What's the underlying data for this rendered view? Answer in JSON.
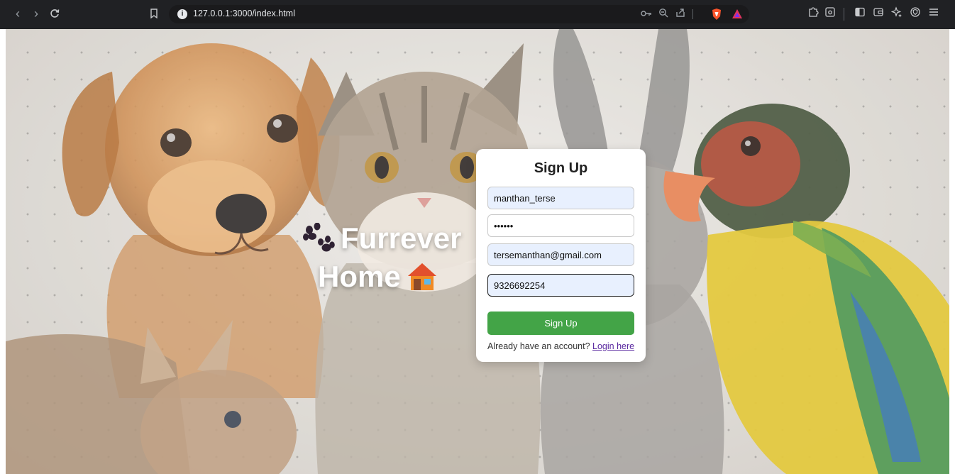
{
  "browser": {
    "url": "127.0.0.1:3000/index.html"
  },
  "brand": {
    "line1": "Furrever",
    "line2": "Home"
  },
  "signup": {
    "title": "Sign Up",
    "username_value": "manthan_terse",
    "password_value": "••••••",
    "email_value": "tersemanthan@gmail.com",
    "phone_value": "9326692254",
    "submit_label": "Sign Up",
    "login_prompt": "Already have an account?",
    "login_link": "Login here"
  },
  "colors": {
    "button_green": "#43a447",
    "link_purple": "#5b2aa0",
    "autofill_blue": "#e8f0fe",
    "chrome_dark": "#202124"
  },
  "icons": [
    "back-icon",
    "forward-icon",
    "reload-icon",
    "bookmark-icon",
    "site-info-icon",
    "key-icon",
    "zoom-icon",
    "share-icon",
    "brave-shield-icon",
    "brave-rewards-icon",
    "extensions-icon",
    "screenshot-icon",
    "sidebar-icon",
    "wallet-icon",
    "leo-icon",
    "vpn-icon",
    "menu-icon",
    "paw-icon",
    "house-icon"
  ]
}
